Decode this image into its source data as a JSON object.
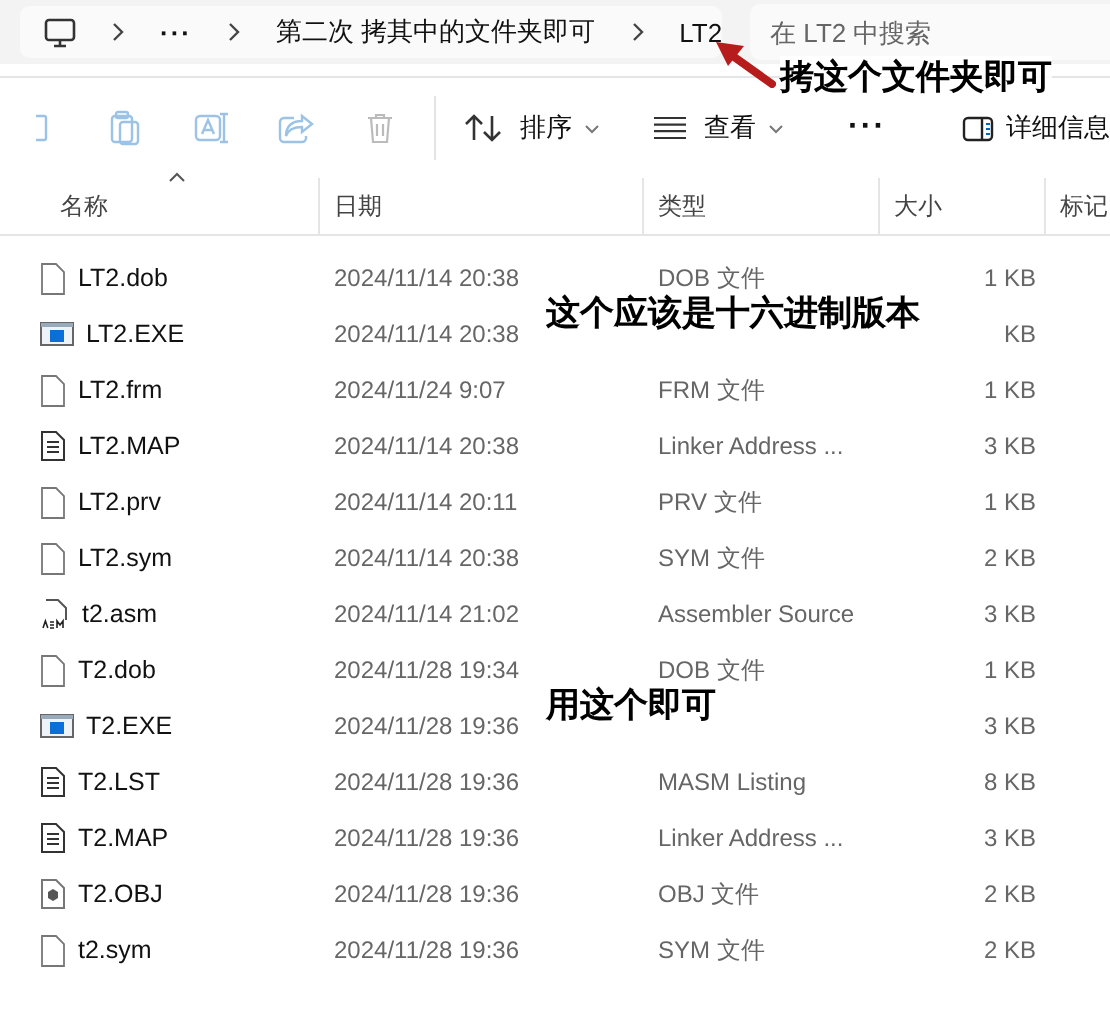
{
  "address_bar": {
    "breadcrumbs": [
      {
        "kind": "more",
        "label": "···"
      },
      {
        "kind": "folder",
        "label": "第二次 拷其中的文件夹即可"
      },
      {
        "kind": "folder",
        "label": "LT2"
      }
    ],
    "search": {
      "placeholder": "在 LT2 中搜索"
    }
  },
  "toolbar": {
    "actions": [
      {
        "kind": "sort",
        "label": "排序",
        "dropdown": true
      },
      {
        "kind": "view",
        "label": "查看",
        "dropdown": true
      },
      {
        "kind": "more",
        "label": "···",
        "dropdown": false
      }
    ],
    "details_button": {
      "label": "详细信息"
    }
  },
  "table": {
    "columns": [
      {
        "label": "名称",
        "sorted": true
      },
      {
        "label": "日期",
        "sorted": false
      },
      {
        "label": "类型",
        "sorted": false
      },
      {
        "label": "大小",
        "sorted": false
      },
      {
        "label": "标记",
        "sorted": false
      }
    ],
    "rows": [
      {
        "kind": "blank",
        "name": "LT2.dob",
        "date": "2024/11/14 20:38",
        "type": "DOB 文件",
        "size": "1 KB"
      },
      {
        "kind": "exe",
        "name": "LT2.EXE",
        "date": "2024/11/14 20:38",
        "size": "KB"
      },
      {
        "kind": "blank",
        "name": "LT2.frm",
        "date": "2024/11/24 9:07",
        "type": "FRM 文件",
        "size": "1 KB"
      },
      {
        "kind": "text",
        "name": "LT2.MAP",
        "date": "2024/11/14 20:38",
        "type": "Linker Address ...",
        "size": "3 KB"
      },
      {
        "kind": "blank",
        "name": "LT2.prv",
        "date": "2024/11/14 20:11",
        "type": "PRV 文件",
        "size": "1 KB"
      },
      {
        "kind": "blank",
        "name": "LT2.sym",
        "date": "2024/11/14 20:38",
        "type": "SYM 文件",
        "size": "2 KB"
      },
      {
        "kind": "asm",
        "name": "t2.asm",
        "date": "2024/11/14 21:02",
        "type": "Assembler Source",
        "size": "3 KB"
      },
      {
        "kind": "blank",
        "name": "T2.dob",
        "date": "2024/11/28 19:34",
        "type": "DOB 文件",
        "size": "1 KB"
      },
      {
        "kind": "exe",
        "name": "T2.EXE",
        "date": "2024/11/28 19:36",
        "size": "3 KB"
      },
      {
        "kind": "text",
        "name": "T2.LST",
        "date": "2024/11/28 19:36",
        "type": "MASM Listing",
        "size": "8 KB"
      },
      {
        "kind": "text",
        "name": "T2.MAP",
        "date": "2024/11/28 19:36",
        "type": "Linker Address ...",
        "size": "3 KB"
      },
      {
        "kind": "obj",
        "name": "T2.OBJ",
        "date": "2024/11/28 19:36",
        "type": "OBJ 文件",
        "size": "2 KB"
      },
      {
        "kind": "blank",
        "name": "t2.sym",
        "date": "2024/11/28 19:36",
        "type": "SYM 文件",
        "size": "2 KB"
      }
    ]
  },
  "annotations": [
    {
      "kind": "arrow",
      "text": "拷这个文件夹即可"
    },
    {
      "kind": "plain",
      "text": "这个应该是十六进制版本"
    },
    {
      "kind": "plain",
      "text": "用这个即可"
    }
  ]
}
